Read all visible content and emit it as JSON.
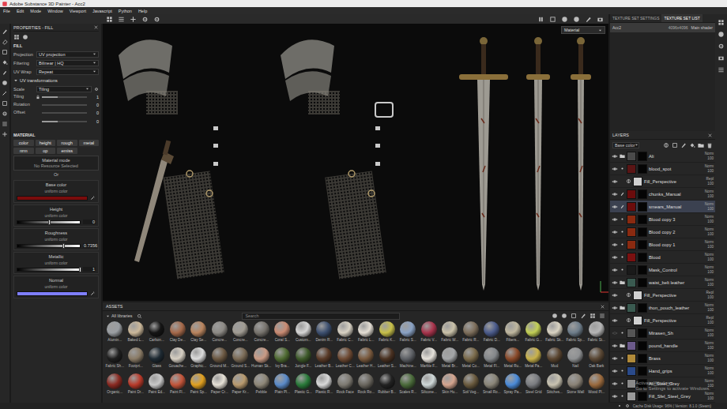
{
  "window": {
    "title": "Adobe Substance 3D Painter - Acc2"
  },
  "menu": [
    "File",
    "Edit",
    "Mode",
    "Window",
    "Viewport",
    "Javascript",
    "Python",
    "Help"
  ],
  "properties": {
    "title": "PROPERTIES - FILL",
    "fill_header": "FILL",
    "fields": [
      {
        "label": "Projection",
        "value": "UV projection"
      },
      {
        "label": "Filtering",
        "value": "Bilinear | HQ"
      },
      {
        "label": "UV Wrap",
        "value": "Repeat"
      }
    ],
    "uv_header": "UV transformations",
    "uv_expanded": true,
    "scale": {
      "label": "Scale",
      "value": "Tiling"
    },
    "uv_sliders": [
      {
        "label": "Tiling",
        "values": [
          "1"
        ],
        "levels": [
          0.35
        ],
        "locked": true
      },
      {
        "label": "Rotation",
        "values": [
          "0"
        ],
        "levels": [
          0.0
        ],
        "locked": false
      },
      {
        "label": "Offset",
        "values": [
          "0",
          "0"
        ],
        "levels": [
          0.0,
          0.35
        ],
        "locked": false
      }
    ],
    "material_header": "MATERIAL",
    "channels": [
      "color",
      "height",
      "rough",
      "metal",
      "nrm",
      "op",
      "emiss"
    ],
    "material_mode": "Material mode",
    "no_resource": "No Resource Selected",
    "or": "Or",
    "params": [
      {
        "label": "Base color",
        "sub": "uniform color",
        "kind": "swatch",
        "color": "#7a0c0c"
      },
      {
        "label": "Height",
        "sub": "uniform color",
        "kind": "slider",
        "value": "0",
        "level": 0.5
      },
      {
        "label": "Roughness",
        "sub": "uniform color",
        "kind": "slider",
        "value": "0.7356",
        "level": 0.7356
      },
      {
        "label": "Metallic",
        "sub": "uniform color",
        "kind": "slider",
        "value": "1",
        "level": 1.0
      },
      {
        "label": "Normal",
        "sub": "uniform color",
        "kind": "swatch",
        "color": "#7f7fff"
      }
    ]
  },
  "viewport": {
    "mode": "Material"
  },
  "assets": {
    "title": "ASSETS",
    "library": "All libraries",
    "search_placeholder": "Search",
    "items": [
      {
        "label": "Alumin...",
        "color": "#9a9ea2"
      },
      {
        "label": "Baked L...",
        "color": "#cbb89a"
      },
      {
        "label": "Carbon...",
        "color": "#151515"
      },
      {
        "label": "Clay De...",
        "color": "#a5694a"
      },
      {
        "label": "Clay Se...",
        "color": "#b8845e"
      },
      {
        "label": "Concre...",
        "color": "#8d8a85"
      },
      {
        "label": "Concre...",
        "color": "#a09b92"
      },
      {
        "label": "Concre...",
        "color": "#77736d"
      },
      {
        "label": "Coral S...",
        "color": "#c98a72"
      },
      {
        "label": "Custom...",
        "color": "#d5d5d5"
      },
      {
        "label": "Denim R...",
        "color": "#3d5070"
      },
      {
        "label": "Fabric C...",
        "color": "#d8d2c4"
      },
      {
        "label": "Fabric L...",
        "color": "#e4ded4"
      },
      {
        "label": "Fabric K...",
        "color": "#c7c04a"
      },
      {
        "label": "Fabric S...",
        "color": "#8aa2c4"
      },
      {
        "label": "Fabric V...",
        "color": "#a8344c"
      },
      {
        "label": "Fabric W...",
        "color": "#c9c1a9"
      },
      {
        "label": "Fabric R...",
        "color": "#7d6e5b"
      },
      {
        "label": "Fabric D...",
        "color": "#4b5b8b"
      },
      {
        "label": "Fibers...",
        "color": "#bfb79f"
      },
      {
        "label": "Fabric G...",
        "color": "#c2cf55"
      },
      {
        "label": "Fabric Sk...",
        "color": "#d9d3c2"
      },
      {
        "label": "Fabric Sp...",
        "color": "#6e7d8a"
      },
      {
        "label": "Fabric St...",
        "color": "#b5b5b5"
      },
      {
        "label": "Fabric Sh...",
        "color": "#1f1f1f"
      },
      {
        "label": "Footpri...",
        "color": "#8a7b66"
      },
      {
        "label": "Glass",
        "color": "#1e2a33"
      },
      {
        "label": "Gouache...",
        "color": "#d6cfc2"
      },
      {
        "label": "Graphic...",
        "color": "#dcdcdc"
      },
      {
        "label": "Ground M...",
        "color": "#6b5842"
      },
      {
        "label": "Ground S...",
        "color": "#7a6a55"
      },
      {
        "label": "Human Sk...",
        "color": "#c99a84"
      },
      {
        "label": "Ivy Bra...",
        "color": "#4f6b32"
      },
      {
        "label": "Jungle F...",
        "color": "#3e5a2a"
      },
      {
        "label": "Leather B...",
        "color": "#5a3b28"
      },
      {
        "label": "Leather C...",
        "color": "#6e4a33"
      },
      {
        "label": "Leather H...",
        "color": "#7a5a3e"
      },
      {
        "label": "Leather S...",
        "color": "#4a3222"
      },
      {
        "label": "Machine...",
        "color": "#5e6166"
      },
      {
        "label": "Marble F...",
        "color": "#e5e1da"
      },
      {
        "label": "Metal Br...",
        "color": "#a4a6a8"
      },
      {
        "label": "Metal Co...",
        "color": "#7a6a4a"
      },
      {
        "label": "Metal Fl...",
        "color": "#84878a"
      },
      {
        "label": "Metal Ru...",
        "color": "#8a4a2a"
      },
      {
        "label": "Metal Pa...",
        "color": "#c9b24a"
      },
      {
        "label": "Mud",
        "color": "#5a4530"
      },
      {
        "label": "Nail",
        "color": "#8f9193"
      },
      {
        "label": "Oak Bark",
        "color": "#5a4835"
      },
      {
        "label": "Organic...",
        "color": "#8a2a22"
      },
      {
        "label": "Paint Dr...",
        "color": "#b83a2a"
      },
      {
        "label": "Paint Ed...",
        "color": "#c8c8c8"
      },
      {
        "label": "Paint Fl...",
        "color": "#c2553a"
      },
      {
        "label": "Paint Sp...",
        "color": "#e0a020"
      },
      {
        "label": "Paper Cr...",
        "color": "#e6e1d6"
      },
      {
        "label": "Paper Kr...",
        "color": "#b89a6e"
      },
      {
        "label": "Pebble",
        "color": "#8e8778"
      },
      {
        "label": "Plain Pl...",
        "color": "#5a8ac8"
      },
      {
        "label": "Plastic G...",
        "color": "#2a7a3a"
      },
      {
        "label": "Plastic R...",
        "color": "#d8d8d8"
      },
      {
        "label": "Rock Face",
        "color": "#7e7a72"
      },
      {
        "label": "Rock Ro...",
        "color": "#6a665e"
      },
      {
        "label": "Rubber B...",
        "color": "#222222"
      },
      {
        "label": "Scales R...",
        "color": "#4a6a3a"
      },
      {
        "label": "Silicone...",
        "color": "#cfd8d8"
      },
      {
        "label": "Skin Hu...",
        "color": "#d4a48e"
      },
      {
        "label": "Soil Veg...",
        "color": "#6a5a3e"
      },
      {
        "label": "Small Ro...",
        "color": "#8a8578"
      },
      {
        "label": "Spray Pa...",
        "color": "#4a8ad8"
      },
      {
        "label": "Steel Grid",
        "color": "#7a7c80"
      },
      {
        "label": "Stitches...",
        "color": "#c8c2b0"
      },
      {
        "label": "Stone Wall",
        "color": "#8a8276"
      },
      {
        "label": "Wood Pl...",
        "color": "#9a6a3e"
      }
    ]
  },
  "right": {
    "tabs": [
      {
        "label": "TEXTURE SET SETTINGS",
        "selected": false
      },
      {
        "label": "TEXTURE SET LIST",
        "selected": true
      }
    ],
    "texture_sets": [
      {
        "name": "Acc2",
        "size": "4096x4096",
        "shader": "Main shader",
        "selected": true
      }
    ],
    "layers": {
      "title": "LAYERS",
      "channel": "Base color",
      "items": [
        {
          "name": "Ali",
          "blend": "Norm",
          "opacity": "100",
          "kind": "folder",
          "visible": true,
          "selected": false,
          "color": "#4a4a4a"
        },
        {
          "name": "blood_spot",
          "blend": "Norm",
          "opacity": "100",
          "kind": "fill",
          "visible": true,
          "selected": false,
          "color": "#5a1515"
        },
        {
          "name": "Fill_Perspective",
          "blend": "Repl",
          "opacity": "100",
          "kind": "effect",
          "visible": true,
          "selected": false,
          "color": "#d0d0d0"
        },
        {
          "name": "chunks_Manual",
          "blend": "Norm",
          "opacity": "100",
          "kind": "paint",
          "visible": true,
          "selected": false,
          "color": "#6b0c0c"
        },
        {
          "name": "smears_Manual",
          "blend": "Norm",
          "opacity": "100",
          "kind": "paint",
          "visible": true,
          "selected": true,
          "color": "#6b0c0c"
        },
        {
          "name": "Blood copy 3",
          "blend": "Norm",
          "opacity": "100",
          "kind": "fill",
          "visible": true,
          "selected": false,
          "color": "#8a2a10"
        },
        {
          "name": "Blood copy 2",
          "blend": "Norm",
          "opacity": "100",
          "kind": "fill",
          "visible": true,
          "selected": false,
          "color": "#8a2a10"
        },
        {
          "name": "Blood copy 1",
          "blend": "Norm",
          "opacity": "100",
          "kind": "fill",
          "visible": true,
          "selected": false,
          "color": "#8a2a10"
        },
        {
          "name": "Blood",
          "blend": "Norm",
          "opacity": "100",
          "kind": "fill",
          "visible": true,
          "selected": false,
          "color": "#7a1010"
        },
        {
          "name": "Mask_Control",
          "blend": "Norm",
          "opacity": "100",
          "kind": "fill",
          "visible": true,
          "selected": false,
          "color": "#1a1a1a"
        },
        {
          "name": "waist_belt leather",
          "blend": "Norm",
          "opacity": "100",
          "kind": "folder",
          "visible": true,
          "selected": false,
          "color": "#3a5a50"
        },
        {
          "name": "Fill_Perspective",
          "blend": "Repl",
          "opacity": "100",
          "kind": "effect",
          "visible": true,
          "selected": false,
          "color": "#d0d0d0"
        },
        {
          "name": "thon_pouch_leather",
          "blend": "Norm",
          "opacity": "100",
          "kind": "folder",
          "visible": true,
          "selected": false,
          "color": "#3a5a50"
        },
        {
          "name": "Fill_Perspective",
          "blend": "Repl",
          "opacity": "100",
          "kind": "effect",
          "visible": true,
          "selected": false,
          "color": "#d0d0d0"
        },
        {
          "name": "Mirasen_Sh",
          "blend": "Norm",
          "opacity": "100",
          "kind": "fill",
          "visible": false,
          "selected": false,
          "color": "#555555"
        },
        {
          "name": "pound_handle",
          "blend": "Norm",
          "opacity": "100",
          "kind": "folder",
          "visible": true,
          "selected": false,
          "color": "#6b5a8a"
        },
        {
          "name": "Brass",
          "blend": "Norm",
          "opacity": "100",
          "kind": "fill",
          "visible": true,
          "selected": false,
          "color": "#b08a3a"
        },
        {
          "name": "Hand_grips",
          "blend": "Norm",
          "opacity": "100",
          "kind": "fill",
          "visible": true,
          "selected": false,
          "color": "#2a4a8a"
        },
        {
          "name": "Ali_Steel_Grey",
          "blend": "Norm",
          "opacity": "100",
          "kind": "fill",
          "visible": true,
          "selected": false,
          "color": "#8a8a8a"
        },
        {
          "name": "Fill_Sfel_Steel_Grey",
          "blend": "Norm",
          "opacity": "100",
          "kind": "fill",
          "visible": true,
          "selected": false,
          "color": "#9a9a9a"
        }
      ]
    }
  },
  "watermark": {
    "line1": "Activate Windows",
    "line2": "Go to Settings to activate Windows."
  },
  "status_bar": "Cache Disk Usage: 96% | Version: 8.1.0 (Steam)"
}
